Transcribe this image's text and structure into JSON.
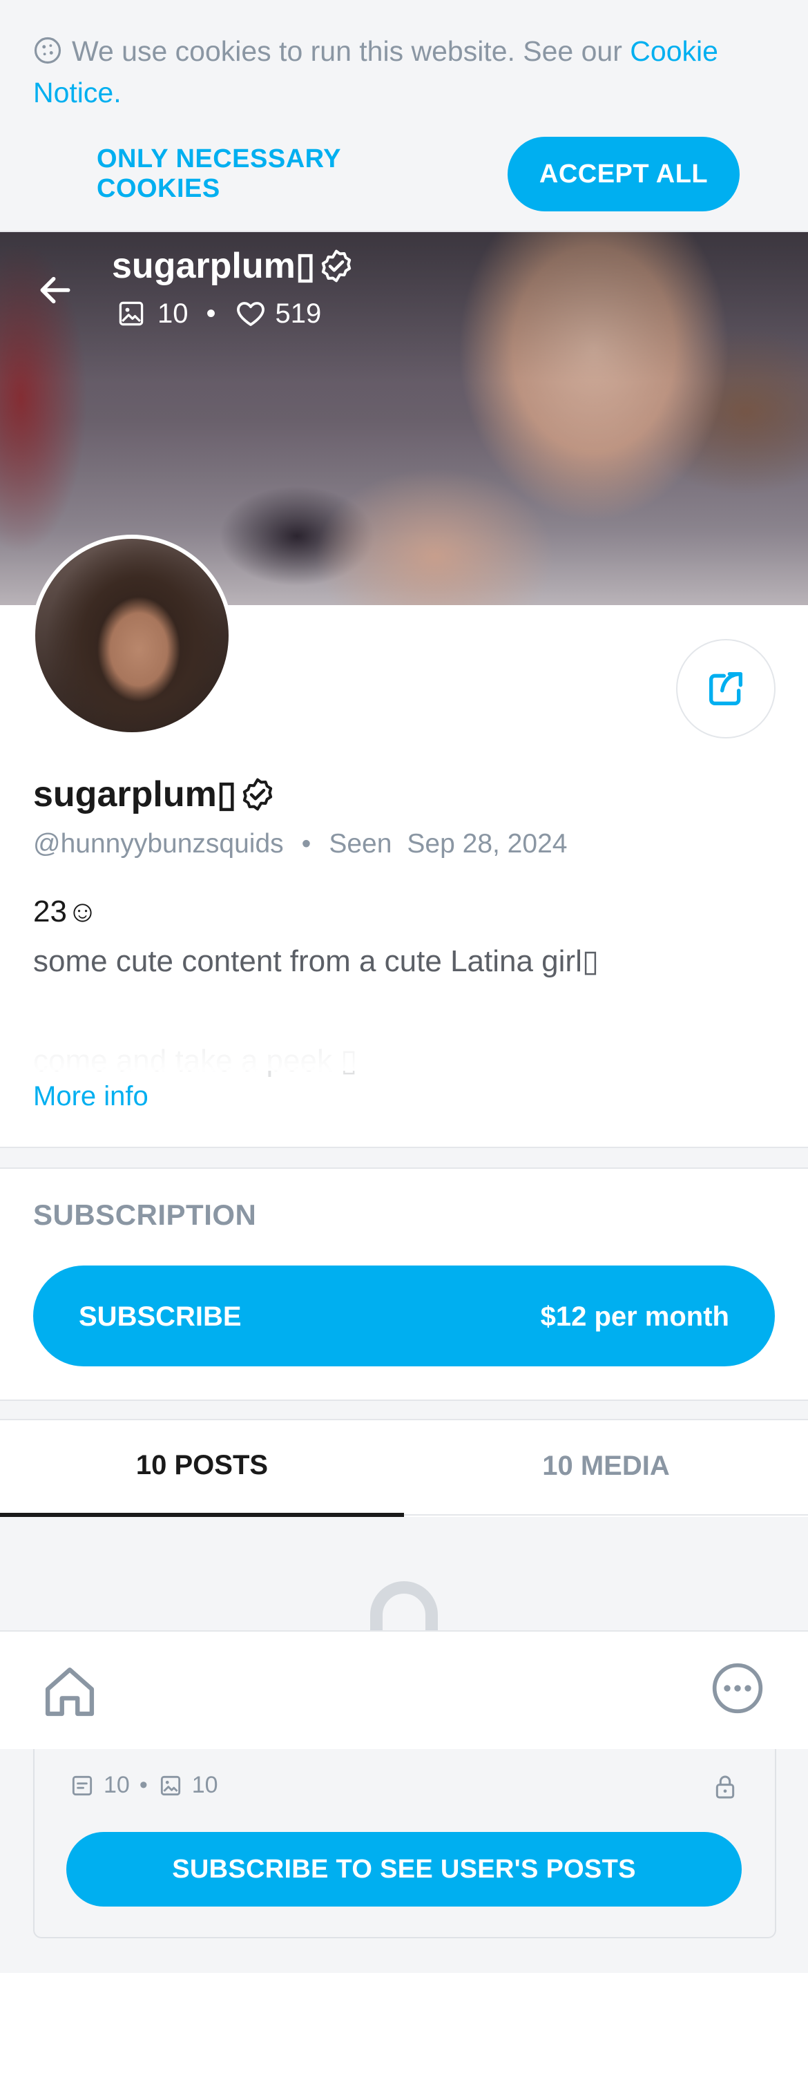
{
  "cookie_banner": {
    "text": "We use cookies to run this website. See our ",
    "link": "Cookie Notice",
    "after": ".",
    "necessary_button": "ONLY NECESSARY COOKIES",
    "accept_button": "ACCEPT ALL"
  },
  "header": {
    "name": "sugarplum▯",
    "media_count": "10",
    "likes_count": "519"
  },
  "profile": {
    "name": "sugarplum▯",
    "handle": "@hunnyybunzsquids",
    "seen_label": "Seen",
    "seen_date": "Sep 28, 2024",
    "bio_line1": "23☺",
    "bio_line2": "some cute content from a cute Latina girl▯",
    "bio_line3": "come and take a peek ▯",
    "more_info": "More info"
  },
  "subscription": {
    "title": "SUBSCRIPTION",
    "button_label": "SUBSCRIBE",
    "price": "$12 per month"
  },
  "tabs": [
    {
      "label": "10 POSTS",
      "active": true
    },
    {
      "label": "10 MEDIA",
      "active": false
    }
  ],
  "locked_card": {
    "posts_count": "10",
    "media_count": "10",
    "button": "SUBSCRIBE TO SEE USER'S POSTS"
  },
  "colors": {
    "accent": "#00aff0",
    "muted": "#8a96a3",
    "background": "#f4f5f7"
  },
  "icons": [
    "cookie-icon",
    "back-arrow-icon",
    "image-icon",
    "heart-icon",
    "verified-icon",
    "share-icon",
    "lock-icon",
    "post-icon",
    "home-icon",
    "more-icon"
  ]
}
